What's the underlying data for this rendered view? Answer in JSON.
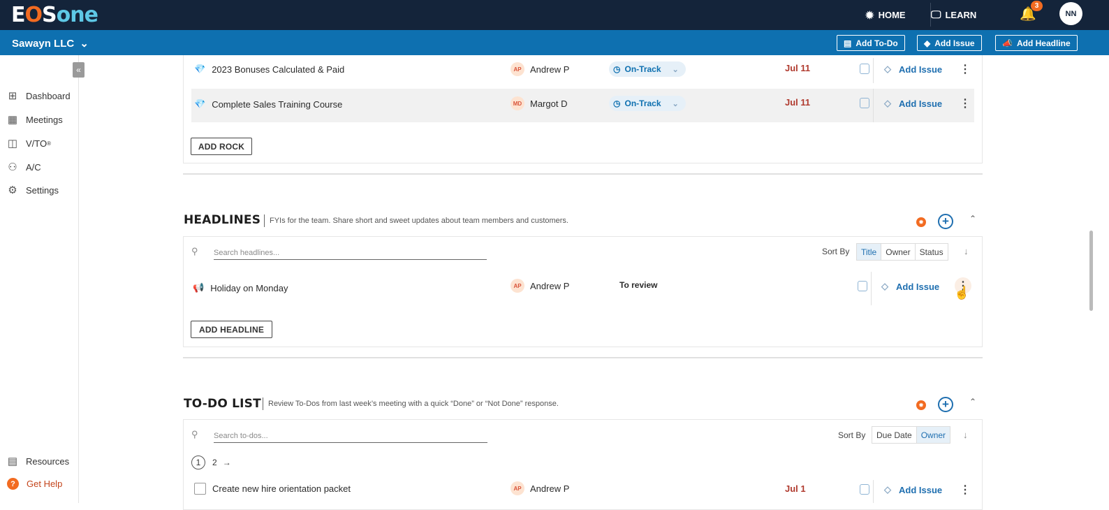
{
  "header": {
    "logo": {
      "e": "E",
      "o": "O",
      "s": "S",
      "one": "one"
    },
    "nav": [
      {
        "label": "HOME",
        "icon": "eos-gear-icon"
      },
      {
        "label": "LEARN",
        "icon": "monitor-icon"
      }
    ],
    "notifications_count": "3",
    "user_initials": "NN"
  },
  "subbar": {
    "company": "Sawayn LLC",
    "buttons": [
      "Add To-Do",
      "Add Issue",
      "Add Headline"
    ]
  },
  "sidebar": {
    "items": [
      {
        "label": "Dashboard",
        "icon": "grid-icon"
      },
      {
        "label": "Meetings",
        "icon": "calendar-icon"
      },
      {
        "label": "V/TO",
        "sup": "®",
        "icon": "layout-icon"
      },
      {
        "label": "A/C",
        "icon": "org-chart-icon"
      },
      {
        "label": "Settings",
        "icon": "gear-icon"
      }
    ],
    "bottom": [
      {
        "label": "Resources",
        "icon": "book-icon"
      },
      {
        "label": "Get Help",
        "icon": "help-icon"
      }
    ]
  },
  "rocks": {
    "rows": [
      {
        "title": "2023 Bonuses Calculated & Paid",
        "owner_initials": "AP",
        "owner": "Andrew P",
        "status": "On-Track",
        "due": "Jul 11",
        "action": "Add Issue"
      },
      {
        "title": "Complete Sales Training Course",
        "owner_initials": "MD",
        "owner": "Margot D",
        "status": "On-Track",
        "due": "Jul 11",
        "action": "Add Issue"
      }
    ],
    "add_button": "ADD ROCK"
  },
  "headlines": {
    "title": "HEADLINES",
    "description": "FYIs for the team. Share short and sweet updates about team members and customers.",
    "search_placeholder": "Search headlines...",
    "sort_by": "Sort By",
    "sort_options": [
      "Title",
      "Owner",
      "Status"
    ],
    "sort_active": "Title",
    "rows": [
      {
        "title": "Holiday on Monday",
        "owner_initials": "AP",
        "owner": "Andrew P",
        "status": "To review",
        "action": "Add Issue"
      }
    ],
    "add_button": "ADD HEADLINE"
  },
  "todos": {
    "title": "TO-DO LIST",
    "description": "Review To-Dos from last week’s meeting with a quick “Done” or “Not Done” response.",
    "search_placeholder": "Search to-dos...",
    "sort_by": "Sort By",
    "sort_options": [
      "Due Date",
      "Owner"
    ],
    "sort_active": "Owner",
    "pages": [
      "1",
      "2"
    ],
    "rows": [
      {
        "title": "Create new hire orientation packet",
        "owner_initials": "AP",
        "owner": "Andrew P",
        "due": "Jul 1",
        "action": "Add Issue"
      }
    ]
  }
}
